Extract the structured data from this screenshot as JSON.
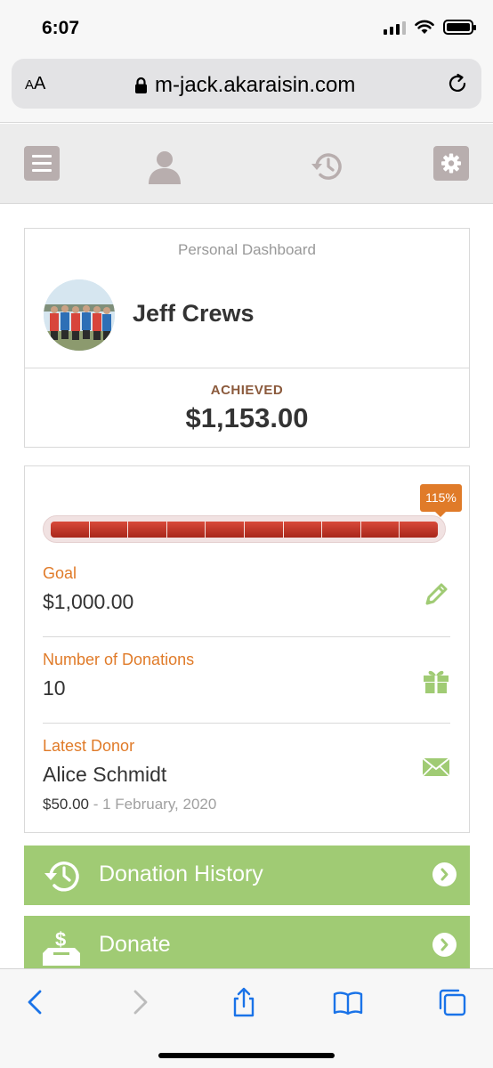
{
  "status_bar": {
    "time": "6:07"
  },
  "browser": {
    "aa_label": "AA",
    "url": "m-jack.akaraisin.com"
  },
  "profile": {
    "dashboard_title": "Personal Dashboard",
    "name": "Jeff Crews",
    "achieved_label": "ACHIEVED",
    "achieved_amount": "$1,153.00"
  },
  "progress": {
    "percent_label": "115%",
    "percent_value": 115,
    "segments": 10
  },
  "stats": {
    "goal_label": "Goal",
    "goal_value": "$1,000.00",
    "donations_label": "Number of Donations",
    "donations_value": "10",
    "latest_donor_label": "Latest Donor",
    "latest_donor_name": "Alice Schmidt",
    "latest_donor_amount": "$50.00",
    "latest_donor_date": "- 1 February, 2020"
  },
  "actions": {
    "history_label": "Donation History",
    "donate_label": "Donate"
  },
  "colors": {
    "accent_orange": "#e07b29",
    "button_green": "#a0cb74",
    "progress_red": "#b8301f",
    "ios_blue": "#1a73e8"
  },
  "icons": {
    "nav": [
      "menu-icon",
      "user-icon",
      "history-icon",
      "gear-icon"
    ],
    "stats": [
      "pencil-icon",
      "gift-icon",
      "envelope-icon"
    ],
    "toolbar": [
      "back-icon",
      "forward-icon",
      "share-icon",
      "bookmarks-icon",
      "tabs-icon"
    ]
  }
}
